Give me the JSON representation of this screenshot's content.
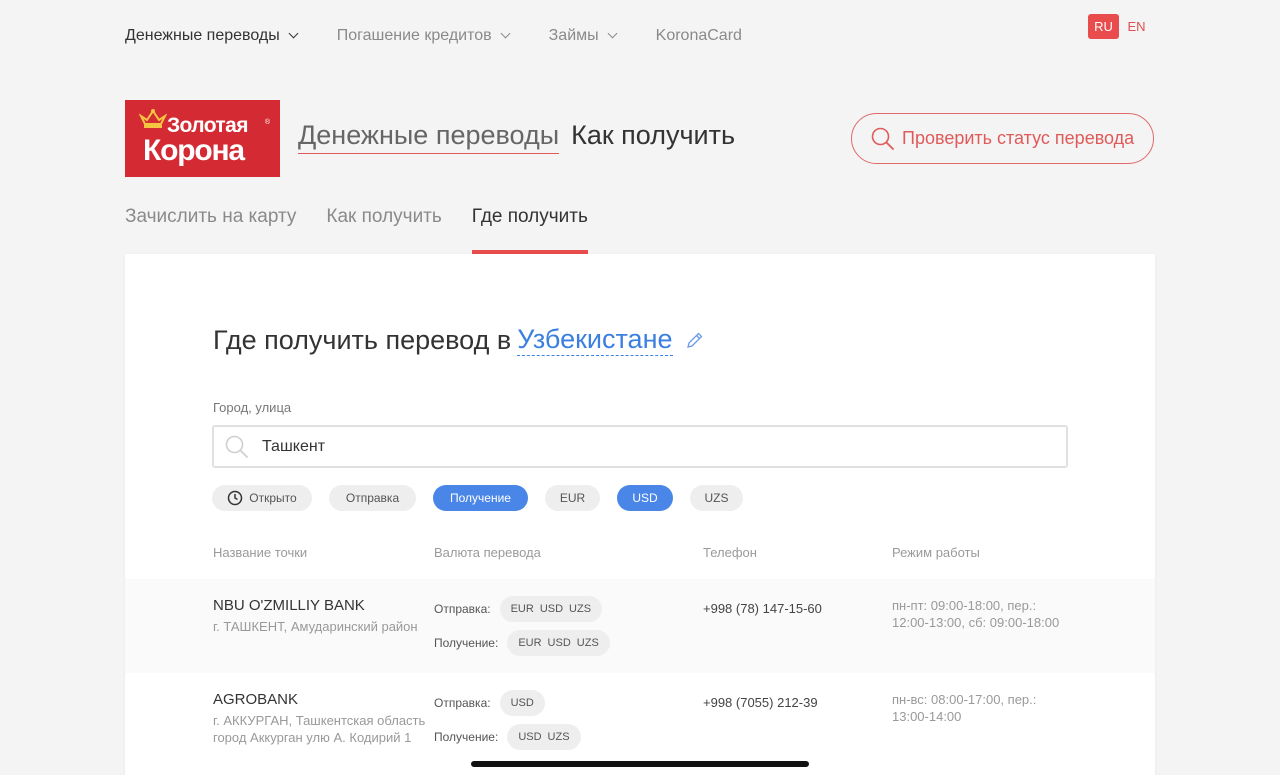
{
  "topnav": {
    "items": [
      {
        "label": "Денежные переводы",
        "active": true,
        "dropdown": true
      },
      {
        "label": "Погашение кредитов",
        "active": false,
        "dropdown": true
      },
      {
        "label": "Займы",
        "active": false,
        "dropdown": true
      },
      {
        "label": "KoronaCard",
        "active": false,
        "dropdown": false
      }
    ]
  },
  "lang": {
    "ru": "RU",
    "en": "EN",
    "active": "RU"
  },
  "logo": {
    "line1": "Золотая",
    "line2": "Корона",
    "reg": "®",
    "bg_color": "#d42a34"
  },
  "breadcrumb": {
    "parent": "Денежные переводы",
    "current": "Как получить"
  },
  "check_status_label": "Проверить статус перевода",
  "tabs": [
    {
      "label": "Зачислить на карту",
      "active": false
    },
    {
      "label": "Как получить",
      "active": false
    },
    {
      "label": "Где получить",
      "active": true
    }
  ],
  "main": {
    "heading_prefix": "Где получить перевод в",
    "country": "Узбекистане",
    "search_label": "Город, улица",
    "search_value": "Ташкент"
  },
  "filters": [
    {
      "label": "Открыто",
      "selected": false,
      "icon": "clock-icon"
    },
    {
      "label": "Отправка",
      "selected": false
    },
    {
      "label": "Получение",
      "selected": true
    },
    {
      "label": "EUR",
      "selected": false
    },
    {
      "label": "USD",
      "selected": true
    },
    {
      "label": "UZS",
      "selected": false
    }
  ],
  "columns": {
    "name": "Название точки",
    "currency": "Валюта перевода",
    "phone": "Телефон",
    "hours": "Режим работы"
  },
  "send_label": "Отправка:",
  "receive_label": "Получение:",
  "points": [
    {
      "name": "NBU O'ZMILLIY BANK",
      "address": "г. ТАШКЕНТ, Амударинский район",
      "send": [
        "EUR",
        "USD",
        "UZS"
      ],
      "receive": [
        "EUR",
        "USD",
        "UZS"
      ],
      "phone": "+998 (78) 147-15-60",
      "hours": "пн-пт: 09:00-18:00, пер.: 12:00-13:00, сб: 09:00-18:00"
    },
    {
      "name": "AGROBANK",
      "address": "г. АККУРГАН, Ташкентская область город Аккурган улю А. Кодирий 1",
      "send": [
        "USD"
      ],
      "receive": [
        "USD",
        "UZS"
      ],
      "phone": "+998 (7055) 212-39",
      "hours": "пн-вс: 08:00-17:00, пер.: 13:00-14:00"
    }
  ],
  "colors": {
    "accent_red": "#e84c4c",
    "accent_blue": "#4a86e8",
    "link_blue": "#3b7fe0"
  }
}
